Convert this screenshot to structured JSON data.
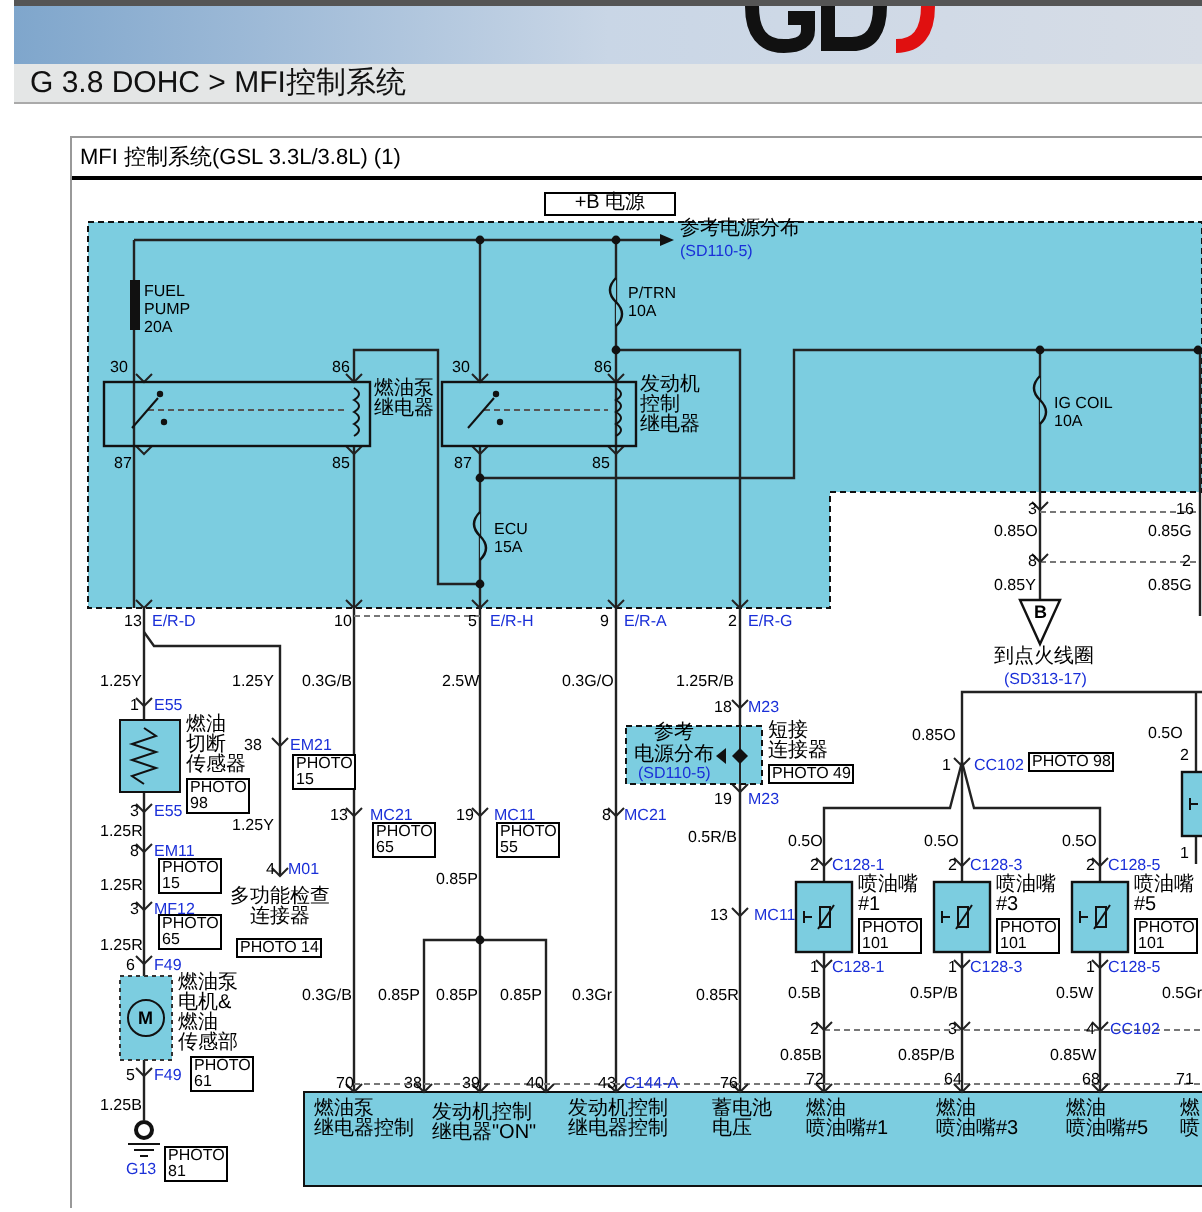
{
  "breadcrumb": "G 3.8 DOHC > MFI控制系统",
  "diagram": {
    "title": "MFI 控制系统(GSL 3.3L/3.8L) (1)",
    "labels": [
      {
        "kind": "bus",
        "text": "+B 电源"
      },
      {
        "kind": "name",
        "text": "参考电源分布"
      },
      {
        "kind": "ref",
        "text": "(SD110-5)"
      },
      {
        "kind": "en",
        "text": "FUEL\nPUMP\n20A"
      },
      {
        "kind": "en",
        "text": "P/TRN\n10A"
      },
      {
        "kind": "pin",
        "text": "30"
      },
      {
        "kind": "pin",
        "text": "86"
      },
      {
        "kind": "name",
        "text": "燃油泵"
      },
      {
        "kind": "name",
        "text": "继电器"
      },
      {
        "kind": "pin",
        "text": "30"
      },
      {
        "kind": "pin",
        "text": "86"
      },
      {
        "kind": "name",
        "text": "发动机"
      },
      {
        "kind": "name",
        "text": "控制"
      },
      {
        "kind": "name",
        "text": "继电器"
      },
      {
        "kind": "pin",
        "text": "87"
      },
      {
        "kind": "pin",
        "text": "85"
      },
      {
        "kind": "pin",
        "text": "87"
      },
      {
        "kind": "pin",
        "text": "85"
      },
      {
        "kind": "en",
        "text": "ECU\n15A"
      },
      {
        "kind": "en",
        "text": "IG COIL\n10A"
      },
      {
        "kind": "pin",
        "text": "3"
      },
      {
        "kind": "pin",
        "text": "16"
      },
      {
        "kind": "wire",
        "text": "0.85O"
      },
      {
        "kind": "wire",
        "text": "0.85G"
      },
      {
        "kind": "pin",
        "text": "8"
      },
      {
        "kind": "pin",
        "text": "2"
      },
      {
        "kind": "wire",
        "text": "0.85Y"
      },
      {
        "kind": "wire",
        "text": "0.85G"
      },
      {
        "kind": "pin",
        "text": "13"
      },
      {
        "kind": "conn",
        "text": "E/R-D"
      },
      {
        "kind": "pin",
        "text": "10"
      },
      {
        "kind": "pin",
        "text": "5"
      },
      {
        "kind": "conn",
        "text": "E/R-H"
      },
      {
        "kind": "pin",
        "text": "9"
      },
      {
        "kind": "conn",
        "text": "E/R-A"
      },
      {
        "kind": "pin",
        "text": "2"
      },
      {
        "kind": "conn",
        "text": "E/R-G"
      },
      {
        "kind": "tri",
        "text": "B"
      },
      {
        "kind": "name",
        "text": "到点火线圈"
      },
      {
        "kind": "wire",
        "text": "1.25Y"
      },
      {
        "kind": "wire",
        "text": "1.25Y"
      },
      {
        "kind": "wire",
        "text": "0.3G/B"
      },
      {
        "kind": "wire",
        "text": "2.5W"
      },
      {
        "kind": "wire",
        "text": "0.3G/O"
      },
      {
        "kind": "wire",
        "text": "1.25R/B"
      },
      {
        "kind": "ref",
        "text": "(SD313-17)"
      },
      {
        "kind": "pin",
        "text": "1"
      },
      {
        "kind": "conn",
        "text": "E55"
      },
      {
        "kind": "pin",
        "text": "18"
      },
      {
        "kind": "conn",
        "text": "M23"
      },
      {
        "kind": "name",
        "text": "燃油"
      },
      {
        "kind": "name",
        "text": "参考"
      },
      {
        "kind": "name",
        "text": "短接"
      },
      {
        "kind": "wire",
        "text": "0.85O"
      },
      {
        "kind": "wire",
        "text": "0.5O"
      },
      {
        "kind": "name",
        "text": "切断"
      },
      {
        "kind": "pin",
        "text": "38"
      },
      {
        "kind": "conn",
        "text": "EM21"
      },
      {
        "kind": "name",
        "text": "电源分布"
      },
      {
        "kind": "name",
        "text": "连接器"
      },
      {
        "kind": "name",
        "text": "传感器"
      },
      {
        "kind": "photo",
        "text": "PHOTO\n15"
      },
      {
        "kind": "ref",
        "text": "(SD110-5)"
      },
      {
        "kind": "photo",
        "text": "PHOTO 49"
      },
      {
        "kind": "pin",
        "text": "1"
      },
      {
        "kind": "conn",
        "text": "CC102"
      },
      {
        "kind": "photo",
        "text": "PHOTO 98"
      },
      {
        "kind": "pin",
        "text": "2"
      },
      {
        "kind": "pin",
        "text": "3"
      },
      {
        "kind": "conn",
        "text": "E55"
      },
      {
        "kind": "photo",
        "text": "PHOTO\n98"
      },
      {
        "kind": "pin",
        "text": "13"
      },
      {
        "kind": "conn",
        "text": "MC21"
      },
      {
        "kind": "pin",
        "text": "19"
      },
      {
        "kind": "conn",
        "text": "MC11"
      },
      {
        "kind": "pin",
        "text": "8"
      },
      {
        "kind": "conn",
        "text": "MC21"
      },
      {
        "kind": "pin",
        "text": "19"
      },
      {
        "kind": "conn",
        "text": "M23"
      },
      {
        "kind": "wire",
        "text": "1.25R"
      },
      {
        "kind": "wire",
        "text": "1.25Y"
      },
      {
        "kind": "photo",
        "text": "PHOTO\n65"
      },
      {
        "kind": "photo",
        "text": "PHOTO\n55"
      },
      {
        "kind": "wire",
        "text": "0.5R/B"
      },
      {
        "kind": "wire",
        "text": "0.5O"
      },
      {
        "kind": "wire",
        "text": "0.5O"
      },
      {
        "kind": "wire",
        "text": "0.5O"
      },
      {
        "kind": "pin",
        "text": "8"
      },
      {
        "kind": "conn",
        "text": "EM11"
      },
      {
        "kind": "pin",
        "text": "1"
      },
      {
        "kind": "photo",
        "text": "PHOTO\n15"
      },
      {
        "kind": "pin",
        "text": "4"
      },
      {
        "kind": "conn",
        "text": "M01"
      },
      {
        "kind": "pin",
        "text": "2"
      },
      {
        "kind": "conn",
        "text": "C128-1"
      },
      {
        "kind": "pin",
        "text": "2"
      },
      {
        "kind": "conn",
        "text": "C128-3"
      },
      {
        "kind": "pin",
        "text": "2"
      },
      {
        "kind": "conn",
        "text": "C128-5"
      },
      {
        "kind": "wire",
        "text": "1.25R"
      },
      {
        "kind": "wire",
        "text": "0.85P"
      },
      {
        "kind": "name",
        "text": "喷油嘴"
      },
      {
        "kind": "name",
        "text": "喷油嘴"
      },
      {
        "kind": "name",
        "text": "喷油嘴"
      },
      {
        "kind": "pin",
        "text": "3"
      },
      {
        "kind": "conn",
        "text": "MF12"
      },
      {
        "kind": "name",
        "text": "多功能检查"
      },
      {
        "kind": "name",
        "text": "连接器"
      },
      {
        "kind": "pin",
        "text": "13"
      },
      {
        "kind": "conn",
        "text": "MC11"
      },
      {
        "kind": "name",
        "text": "#1"
      },
      {
        "kind": "name",
        "text": "#3"
      },
      {
        "kind": "name",
        "text": "#5"
      },
      {
        "kind": "wire",
        "text": "1.25R"
      },
      {
        "kind": "photo",
        "text": "PHOTO\n65"
      },
      {
        "kind": "photo",
        "text": "PHOTO 14"
      },
      {
        "kind": "photo",
        "text": "PHOTO\n101"
      },
      {
        "kind": "photo",
        "text": "PHOTO\n101"
      },
      {
        "kind": "photo",
        "text": "PHOTO\n101"
      },
      {
        "kind": "pin",
        "text": "6"
      },
      {
        "kind": "conn",
        "text": "F49"
      },
      {
        "kind": "pin",
        "text": "1"
      },
      {
        "kind": "conn",
        "text": "C128-1"
      },
      {
        "kind": "pin",
        "text": "1"
      },
      {
        "kind": "conn",
        "text": "C128-3"
      },
      {
        "kind": "pin",
        "text": "1"
      },
      {
        "kind": "conn",
        "text": "C128-5"
      },
      {
        "kind": "name",
        "text": "燃油泵"
      },
      {
        "kind": "name",
        "text": "电机&"
      },
      {
        "kind": "wire",
        "text": "0.3G/B"
      },
      {
        "kind": "wire",
        "text": "0.85P"
      },
      {
        "kind": "wire",
        "text": "0.85P"
      },
      {
        "kind": "wire",
        "text": "0.85P"
      },
      {
        "kind": "wire",
        "text": "0.3Gr"
      },
      {
        "kind": "wire",
        "text": "0.85R"
      },
      {
        "kind": "wire",
        "text": "0.5B"
      },
      {
        "kind": "wire",
        "text": "0.5P/B"
      },
      {
        "kind": "wire",
        "text": "0.5W"
      },
      {
        "kind": "wire",
        "text": "0.5Gr"
      },
      {
        "kind": "motor",
        "text": "M"
      },
      {
        "kind": "name",
        "text": "燃油"
      },
      {
        "kind": "pin",
        "text": "2"
      },
      {
        "kind": "pin",
        "text": "3"
      },
      {
        "kind": "pin",
        "text": "4"
      },
      {
        "kind": "conn",
        "text": "CC102"
      },
      {
        "kind": "name",
        "text": "传感部"
      },
      {
        "kind": "pin",
        "text": "5"
      },
      {
        "kind": "conn",
        "text": "F49"
      },
      {
        "kind": "photo",
        "text": "PHOTO\n61"
      },
      {
        "kind": "wire",
        "text": "0.85B"
      },
      {
        "kind": "wire",
        "text": "0.85P/B"
      },
      {
        "kind": "wire",
        "text": "0.85W"
      },
      {
        "kind": "pin",
        "text": "70"
      },
      {
        "kind": "pin",
        "text": "38"
      },
      {
        "kind": "pin",
        "text": "39"
      },
      {
        "kind": "pin",
        "text": "40"
      },
      {
        "kind": "pin",
        "text": "43"
      },
      {
        "kind": "conn",
        "text": "C144-A"
      },
      {
        "kind": "pin",
        "text": "76"
      },
      {
        "kind": "pin",
        "text": "72"
      },
      {
        "kind": "pin",
        "text": "64"
      },
      {
        "kind": "pin",
        "text": "68"
      },
      {
        "kind": "pin",
        "text": "71"
      },
      {
        "kind": "wire",
        "text": "1.25B"
      },
      {
        "kind": "name",
        "text": "燃油泵"
      },
      {
        "kind": "name",
        "text": "发动机控制"
      },
      {
        "kind": "name",
        "text": "发动机控制"
      },
      {
        "kind": "name",
        "text": "蓄电池"
      },
      {
        "kind": "name",
        "text": "燃油"
      },
      {
        "kind": "name",
        "text": "燃油"
      },
      {
        "kind": "name",
        "text": "燃油"
      },
      {
        "kind": "name",
        "text": "燃"
      },
      {
        "kind": "name",
        "text": "继电器控制"
      },
      {
        "kind": "name",
        "text": "继电器\"ON\""
      },
      {
        "kind": "name",
        "text": "继电器控制"
      },
      {
        "kind": "name",
        "text": "电压"
      },
      {
        "kind": "name",
        "text": "喷油嘴#1"
      },
      {
        "kind": "name",
        "text": "喷油嘴#3"
      },
      {
        "kind": "name",
        "text": "喷油嘴#5"
      },
      {
        "kind": "name",
        "text": "喷"
      },
      {
        "kind": "conn",
        "text": "G13"
      },
      {
        "kind": "photo",
        "text": "PHOTO\n81"
      }
    ]
  }
}
